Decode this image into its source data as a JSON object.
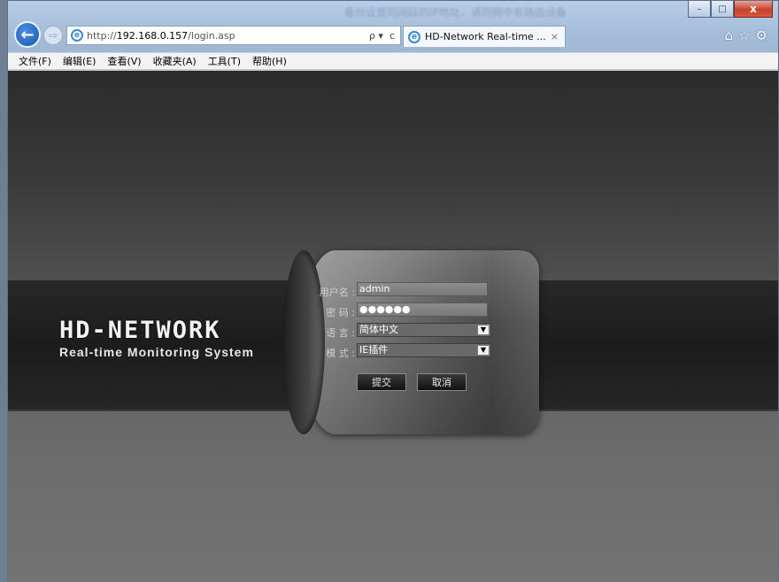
{
  "browser": {
    "url_prefix": "http://",
    "url_host": "192.168.0.157",
    "url_path": "/login.asp",
    "address_tools": "ρ ▾  c",
    "tab_title": "HD-Network Real-time ...",
    "tab_close": "×",
    "window_controls": {
      "minimize": "–",
      "maximize": "□",
      "close": "x"
    },
    "right_tools": {
      "home": "⌂",
      "favorites": "☆",
      "settings": "⚙"
    },
    "background_blur_text": "备份设置同网段的IP地址，请同网中有路由设备"
  },
  "menubar": {
    "items": [
      "文件(F)",
      "编辑(E)",
      "查看(V)",
      "收藏夹(A)",
      "工具(T)",
      "帮助(H)"
    ]
  },
  "logo": {
    "brand": "HD-NETWORK",
    "subtitle": "Real-time Monitoring System"
  },
  "login": {
    "username_label": "用户名 :",
    "username_value": "admin",
    "password_label": "密 码 :",
    "password_value": "●●●●●●",
    "language_label": "语 言 :",
    "language_value": "简体中文",
    "mode_label": "模 式 :",
    "mode_value": "IE插件",
    "submit_label": "提交",
    "cancel_label": "取消"
  },
  "colors": {
    "background_dark": "#2b2b2b",
    "band": "#1c1c1c",
    "accent_ie_blue": "#1a56b0"
  }
}
